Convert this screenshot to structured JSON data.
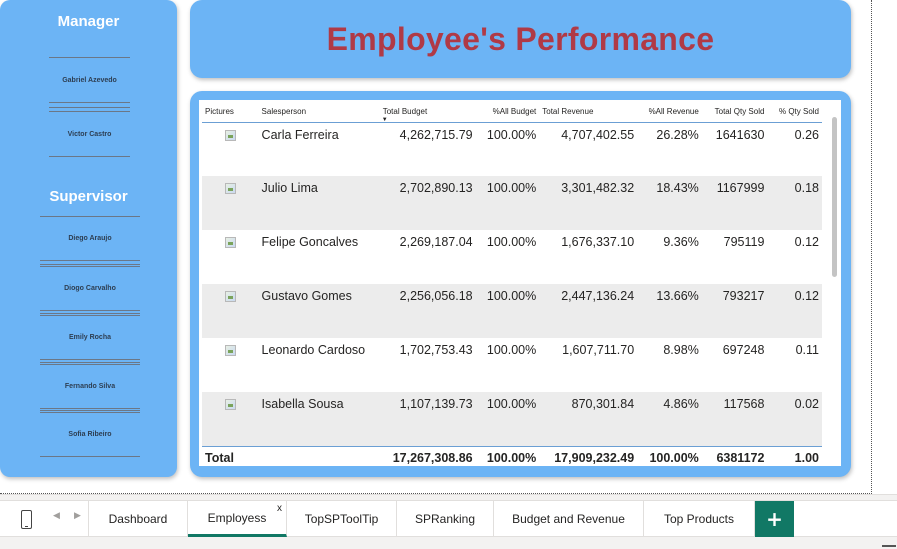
{
  "sidebar": {
    "manager_heading": "Manager",
    "managers": [
      "Gabriel Azevedo",
      "Victor Castro"
    ],
    "supervisor_heading": "Supervisor",
    "supervisors": [
      "Diego Araujo",
      "Diogo Carvalho",
      "Emily Rocha",
      "Fernando Silva",
      "Sofia Ribeiro"
    ]
  },
  "header": {
    "title": "Employee's Performance"
  },
  "table": {
    "columns": [
      "Pictures",
      "Salesperson",
      "Total Budget",
      "%All Budget",
      "Total Revenue",
      "%All Revenue",
      "Total Qty Sold",
      "% Qty Sold"
    ],
    "rows": [
      [
        "",
        "Carla Ferreira",
        "4,262,715.79",
        "100.00%",
        "4,707,402.55",
        "26.28%",
        "1641630",
        "0.26"
      ],
      [
        "",
        "Julio Lima",
        "2,702,890.13",
        "100.00%",
        "3,301,482.32",
        "18.43%",
        "1167999",
        "0.18"
      ],
      [
        "",
        "Felipe Goncalves",
        "2,269,187.04",
        "100.00%",
        "1,676,337.10",
        "9.36%",
        "795119",
        "0.12"
      ],
      [
        "",
        "Gustavo Gomes",
        "2,256,056.18",
        "100.00%",
        "2,447,136.24",
        "13.66%",
        "793217",
        "0.12"
      ],
      [
        "",
        "Leonardo Cardoso",
        "1,702,753.43",
        "100.00%",
        "1,607,711.70",
        "8.98%",
        "697248",
        "0.11"
      ],
      [
        "",
        "Isabella Sousa",
        "1,107,139.73",
        "100.00%",
        "870,301.84",
        "4.86%",
        "117568",
        "0.02"
      ]
    ],
    "total": [
      "Total",
      "",
      "17,267,308.86",
      "100.00%",
      "17,909,232.49",
      "100.00%",
      "6381172",
      "1.00"
    ]
  },
  "tabs": {
    "items": [
      "Dashboard",
      "Employess",
      "TopSPToolTip",
      "SPRanking",
      "Budget and Revenue",
      "Top Products"
    ],
    "active": "Employess",
    "close_label": "x",
    "add_label": "+"
  },
  "colors": {
    "panel": "#6cb4f5",
    "title": "#b03a46",
    "accent": "#117865"
  }
}
